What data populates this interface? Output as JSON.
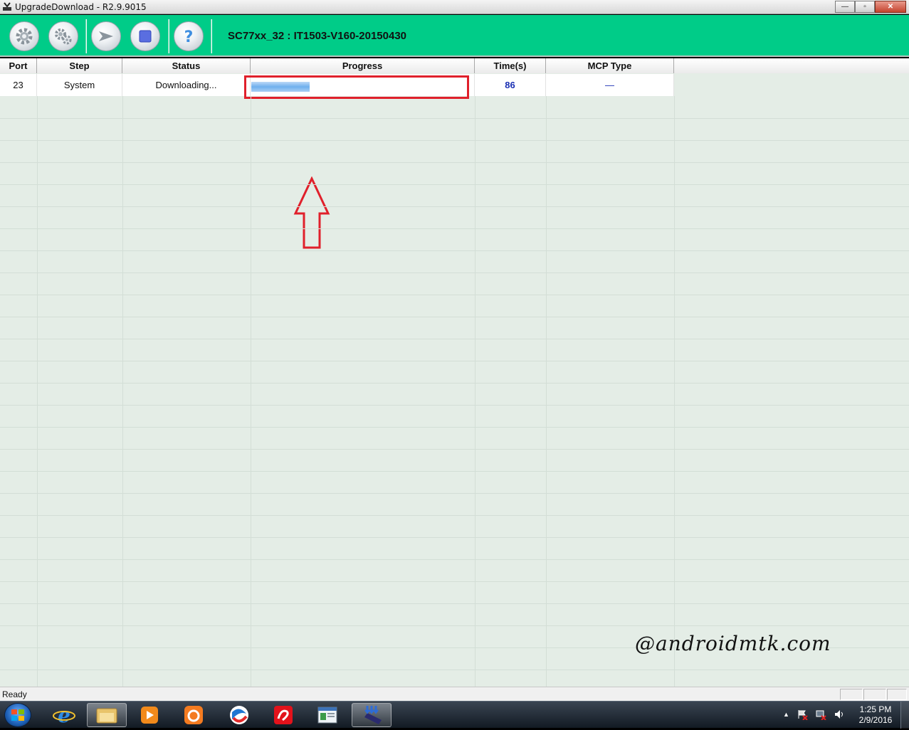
{
  "window": {
    "title": "UpgradeDownload - R2.9.9015",
    "minimize": "—",
    "maximize": "▫",
    "close": "✕"
  },
  "toolbar": {
    "buttons": [
      {
        "name": "load-packet-button",
        "icon": "gear-icon"
      },
      {
        "name": "settings-button",
        "icon": "gears-icon"
      },
      {
        "name": "start-download-button",
        "icon": "play-arrow-icon"
      },
      {
        "name": "stop-download-button",
        "icon": "stop-square-icon"
      },
      {
        "name": "help-button",
        "icon": "question-mark-icon"
      }
    ],
    "firmware_title": "SC77xx_32 : IT1503-V160-20150430",
    "accent_color": "#00cc88"
  },
  "table": {
    "columns": [
      "Port",
      "Step",
      "Status",
      "Progress",
      "Time(s)",
      "MCP Type"
    ],
    "rows": [
      {
        "port": "23",
        "step": "System",
        "status": "Downloading...",
        "progress_fraction": 0.26,
        "time": "86",
        "mcp_type": "—"
      }
    ],
    "highlight_color": "#e0202b"
  },
  "watermark": "@androidmtk.com",
  "statusbar": {
    "text": "Ready"
  },
  "taskbar": {
    "apps": [
      "ie-icon",
      "explorer-icon",
      "media-player-icon",
      "uc-browser-icon",
      "browser-icon",
      "airtel-icon",
      "window-app-icon",
      "upgrade-download-icon"
    ],
    "clock_time": "1:25 PM",
    "clock_date": "2/9/2016",
    "tray_arrow": "▲"
  }
}
